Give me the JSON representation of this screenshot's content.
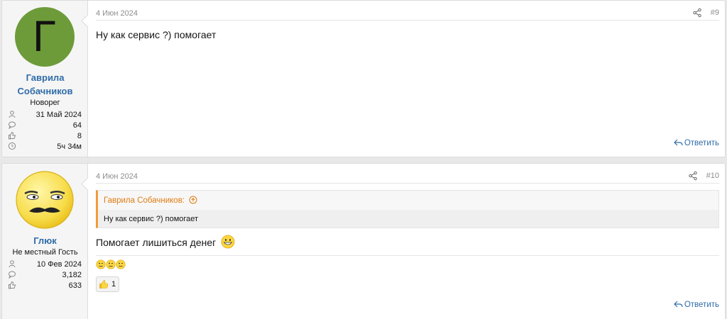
{
  "posts": [
    {
      "author": {
        "name": "Гаврила Собачников",
        "name_line1": "Гаврила",
        "name_line2": "Собачников",
        "avatar_letter": "Г",
        "avatar_color": "#6d9b3a",
        "title": "Новорег",
        "stats": {
          "joined": "31 Май 2024",
          "messages": "64",
          "reactions": "8",
          "time": "5ч 34м"
        }
      },
      "date": "4 Июн 2024",
      "number": "#9",
      "body": "Ну как сервис ?) помогает",
      "reply_label": "Ответить"
    },
    {
      "author": {
        "name": "Глюк",
        "title": "Не местный Гость",
        "stats": {
          "joined": "10 Фев 2024",
          "messages": "3,182",
          "reactions": "633"
        }
      },
      "date": "4 Июн 2024",
      "number": "#10",
      "quote": {
        "author": "Гаврила Собачников:",
        "text": "Ну как сервис ?) помогает"
      },
      "body": "Помогает лишиться денег",
      "reaction": {
        "icon": "thumbs-up",
        "count": "1"
      },
      "reply_label": "Ответить"
    }
  ],
  "colors": {
    "link": "#2f6ca8",
    "quote_accent": "#f29a3a"
  }
}
